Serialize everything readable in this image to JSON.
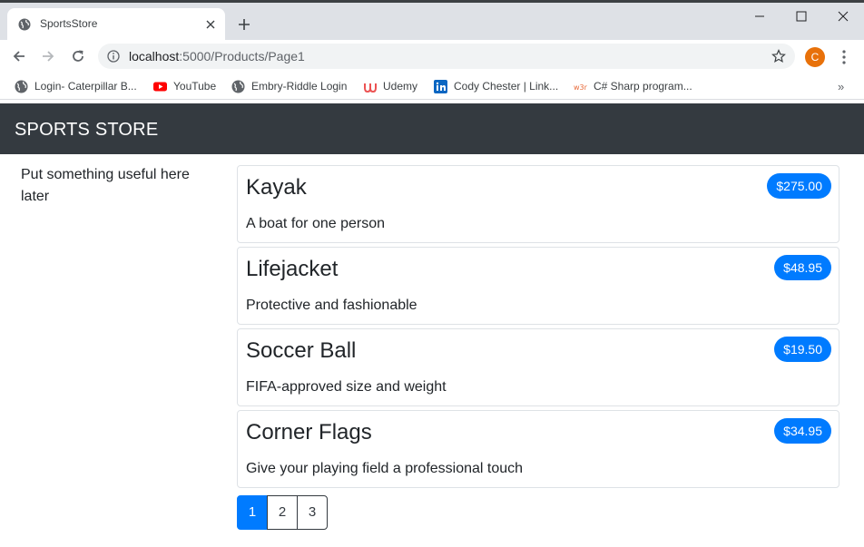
{
  "browser": {
    "tab_title": "SportsStore",
    "url_host": "localhost",
    "url_rest": ":5000/Products/Page1",
    "profile_initial": "C",
    "bookmarks": [
      {
        "label": "Login- Caterpillar B...",
        "icon": "globe-icon"
      },
      {
        "label": "YouTube",
        "icon": "youtube-icon"
      },
      {
        "label": "Embry-Riddle Login",
        "icon": "globe-icon"
      },
      {
        "label": "Udemy",
        "icon": "udemy-icon"
      },
      {
        "label": "Cody Chester | Link...",
        "icon": "linkedin-icon"
      },
      {
        "label": "C# Sharp program...",
        "icon": "w3r-icon"
      }
    ],
    "bookmarks_more": "»"
  },
  "site": {
    "brand": "SPORTS STORE",
    "sidebar_text": "Put something useful here later"
  },
  "products": [
    {
      "name": "Kayak",
      "price": "$275.00",
      "description": "A boat for one person"
    },
    {
      "name": "Lifejacket",
      "price": "$48.95",
      "description": "Protective and fashionable"
    },
    {
      "name": "Soccer Ball",
      "price": "$19.50",
      "description": "FIFA-approved size and weight"
    },
    {
      "name": "Corner Flags",
      "price": "$34.95",
      "description": "Give your playing field a professional touch"
    }
  ],
  "pagination": {
    "pages": [
      "1",
      "2",
      "3"
    ],
    "current": "1"
  },
  "colors": {
    "navbar_bg": "#343a40",
    "price_badge": "#007bff",
    "active_page": "#007bff"
  }
}
